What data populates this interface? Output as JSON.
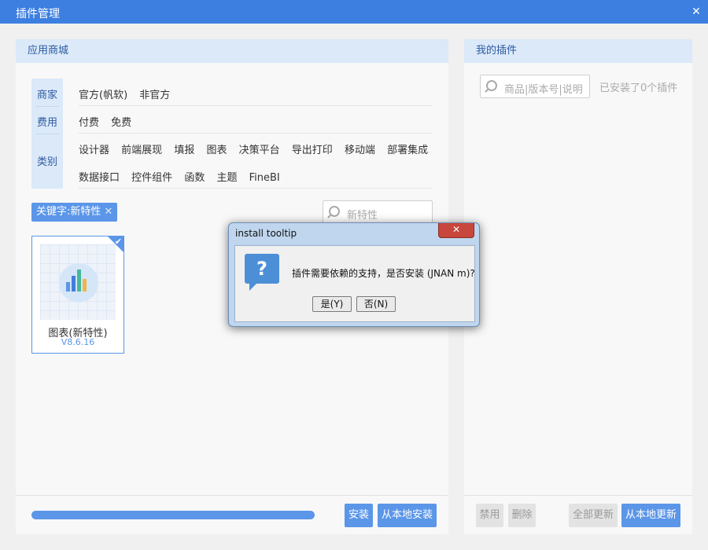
{
  "window": {
    "title": "插件管理",
    "close": "✕"
  },
  "store": {
    "header": "应用商城",
    "categories": [
      "商家",
      "费用",
      "类别"
    ],
    "vendor_options": [
      "官方(帆软)",
      "非官方"
    ],
    "fee_options": [
      "付费",
      "免费"
    ],
    "type_options_row1": [
      "设计器",
      "前端展现",
      "填报",
      "图表",
      "决策平台",
      "导出打印",
      "移动端",
      "部署集成"
    ],
    "type_options_row2": [
      "数据接口",
      "控件组件",
      "函数",
      "主题",
      "FineBI"
    ],
    "keyword_tag": "关键字:新特性",
    "keyword_remove": "✕",
    "search_placeholder": "新特性",
    "card": {
      "name": "图表(新特性)",
      "version": "V8.6.16"
    },
    "install_button": "安装",
    "local_install_button": "从本地安装"
  },
  "mine": {
    "header": "我的插件",
    "search_placeholder": "商品|版本号|说明",
    "installed_text": "已安装了0个插件",
    "disable_button": "禁用",
    "delete_button": "删除",
    "update_all_button": "全部更新",
    "local_update_button": "从本地更新"
  },
  "dialog": {
    "title": "install tooltip",
    "close": "✕",
    "message": "插件需要依赖的支持，是否安装 (JNAN m)?",
    "yes": "是(Y)",
    "no": "否(N)"
  },
  "colors": {
    "accent": "#5b96e8",
    "titlebar": "#3d7fe0",
    "header_bg": "#dbe9f9"
  }
}
